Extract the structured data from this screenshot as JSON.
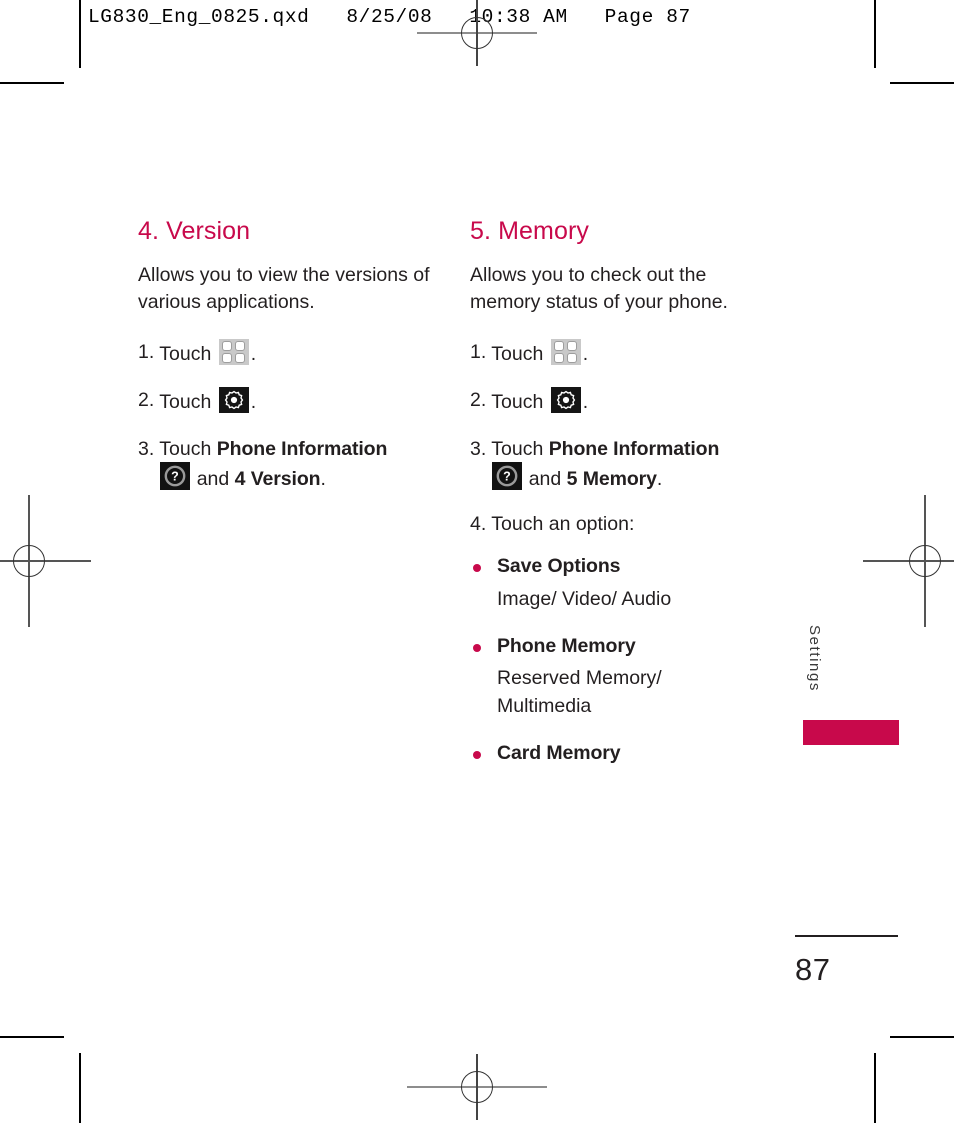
{
  "proof_header": "LG830_Eng_0825.qxd   8/25/08   10:38 AM   Page 87",
  "colors": {
    "accent": "#C8094B",
    "body_text": "#231F20",
    "grid_icon_plate": "#C9C9C9",
    "dark_icon_plate": "#151515"
  },
  "sections": {
    "left": {
      "title": "4. Version",
      "intro": "Allows you to view the versions of various applications.",
      "steps": [
        {
          "num": "1.",
          "lead": "Touch",
          "icon": "grid-icon",
          "trail": "."
        },
        {
          "num": "2.",
          "lead": "Touch",
          "icon": "gear-icon",
          "trail": "."
        },
        {
          "num": "3.",
          "lead": "Touch",
          "bold_target": "Phone Information",
          "icon": "help-icon",
          "conjunction": "and",
          "bold_target2": "4 Version",
          "trail": "."
        }
      ]
    },
    "right": {
      "title": "5. Memory",
      "intro": "Allows you to check out the memory status of your phone.",
      "steps": [
        {
          "num": "1.",
          "lead": "Touch",
          "icon": "grid-icon",
          "trail": "."
        },
        {
          "num": "2.",
          "lead": "Touch",
          "icon": "gear-icon",
          "trail": "."
        },
        {
          "num": "3.",
          "lead": "Touch",
          "bold_target": "Phone Information",
          "icon": "help-icon",
          "conjunction": "and",
          "bold_target2": "5 Memory",
          "trail": "."
        },
        {
          "num": "4.",
          "lead": "Touch an option:"
        }
      ],
      "options": [
        {
          "label": "Save Options",
          "sub": "Image/ Video/ Audio"
        },
        {
          "label": "Phone Memory",
          "sub": "Reserved Memory/ Multimedia"
        },
        {
          "label": "Card Memory",
          "sub": ""
        }
      ]
    }
  },
  "side_tab": {
    "label": "Settings"
  },
  "folio": {
    "page_number": "87"
  }
}
